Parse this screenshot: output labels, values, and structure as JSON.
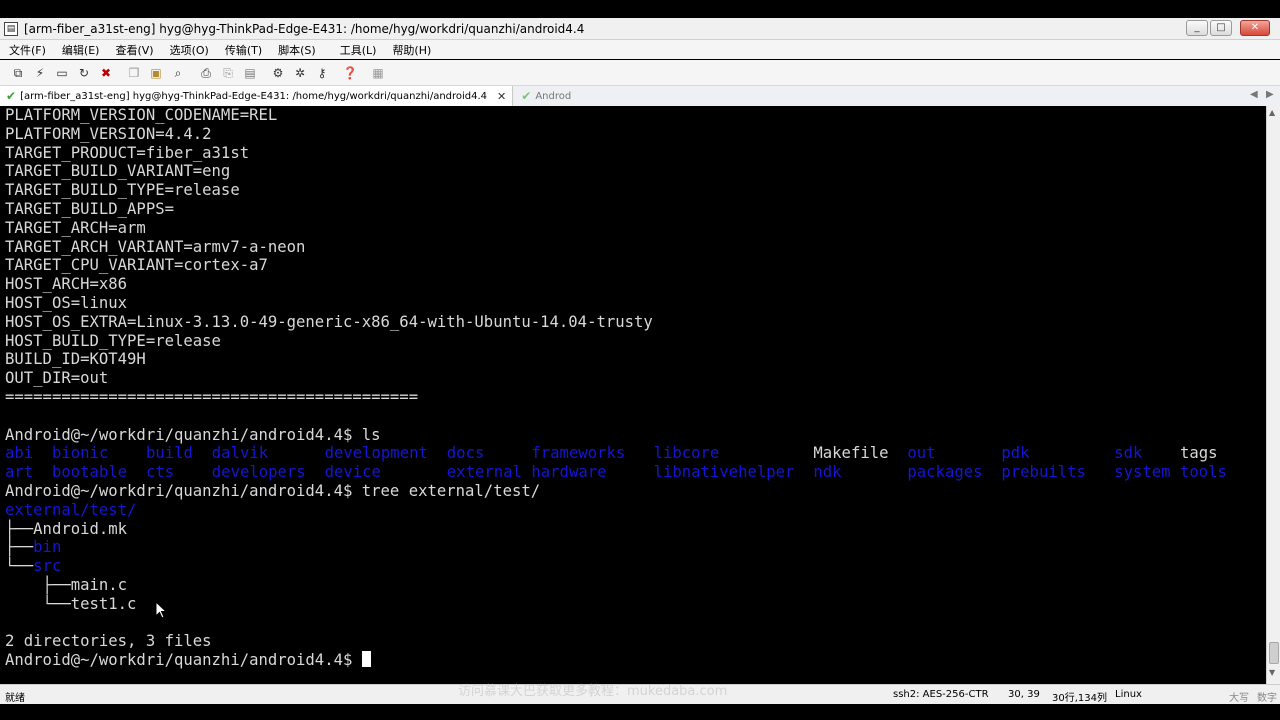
{
  "window": {
    "title": "[arm-fiber_a31st-eng] hyg@hyg-ThinkPad-Edge-E431: /home/hyg/workdri/quanzhi/android4.4",
    "icon": "terminal-app-icon"
  },
  "menu": {
    "file": "文件(F)",
    "edit": "编辑(E)",
    "view": "查看(V)",
    "options": "选项(O)",
    "transfer": "传输(T)",
    "script": "脚本(S)",
    "tools": "工具(L)",
    "help": "帮助(H)"
  },
  "toolbar": {
    "icons": [
      "connect-icon",
      "quick-connect-icon",
      "connect-tab-icon",
      "reconnect-icon",
      "disconnect-icon",
      "copy-icon",
      "paste-icon",
      "find-icon",
      "print-icon",
      "print-setup-icon",
      "print-screen-icon",
      "session-options-icon",
      "global-options-icon",
      "keymap-icon",
      "help-icon",
      "sftp-icon"
    ]
  },
  "tabs": {
    "session": "[arm-fiber_a31st-eng] hyg@hyg-ThinkPad-Edge-E431: /home/hyg/workdri/quanzhi/android4.4",
    "second": "Androd",
    "close": "✕",
    "ok_color": "#3aa13a"
  },
  "terminal": {
    "colors": {
      "fg": "#d8d8d8",
      "dir": "#1515d6",
      "bg": "#000000"
    },
    "lines_before": [
      "PLATFORM_VERSION_CODENAME=REL",
      "PLATFORM_VERSION=4.4.2",
      "TARGET_PRODUCT=fiber_a31st",
      "TARGET_BUILD_VARIANT=eng",
      "TARGET_BUILD_TYPE=release",
      "TARGET_BUILD_APPS=",
      "TARGET_ARCH=arm",
      "TARGET_ARCH_VARIANT=armv7-a-neon",
      "TARGET_CPU_VARIANT=cortex-a7",
      "HOST_ARCH=x86",
      "HOST_OS=linux",
      "HOST_OS_EXTRA=Linux-3.13.0-49-generic-x86_64-with-Ubuntu-14.04-trusty",
      "HOST_BUILD_TYPE=release",
      "BUILD_ID=KOT49H",
      "OUT_DIR=out",
      "============================================",
      "",
      "Android@~/workdri/quanzhi/android4.4$ ls"
    ],
    "ls_row1": [
      {
        "name": "abi",
        "dir": true
      },
      {
        "name": "bionic",
        "dir": true
      },
      {
        "name": "build",
        "dir": true
      },
      {
        "name": "dalvik",
        "dir": true
      },
      {
        "name": "development",
        "dir": true
      },
      {
        "name": "docs",
        "dir": true
      },
      {
        "name": "frameworks",
        "dir": true
      },
      {
        "name": "libcore",
        "dir": true
      },
      {
        "name": "Makefile",
        "dir": false
      },
      {
        "name": "out",
        "dir": true
      },
      {
        "name": "pdk",
        "dir": true
      },
      {
        "name": "sdk",
        "dir": true
      },
      {
        "name": "tags",
        "dir": false
      }
    ],
    "ls_row2": [
      {
        "name": "art",
        "dir": true
      },
      {
        "name": "bootable",
        "dir": true
      },
      {
        "name": "cts",
        "dir": true
      },
      {
        "name": "developers",
        "dir": true
      },
      {
        "name": "device",
        "dir": true
      },
      {
        "name": "external",
        "dir": true
      },
      {
        "name": "hardware",
        "dir": true
      },
      {
        "name": "libnativehelper",
        "dir": true
      },
      {
        "name": "ndk",
        "dir": true
      },
      {
        "name": "packages",
        "dir": true
      },
      {
        "name": "prebuilts",
        "dir": true
      },
      {
        "name": "system",
        "dir": true
      },
      {
        "name": "tools",
        "dir": true
      }
    ],
    "tree_cmd": "Android@~/workdri/quanzhi/android4.4$ tree external/test/",
    "tree_root": "external/test/",
    "tree": [
      {
        "prefix": "├──",
        "name": "Android.mk",
        "dir": false
      },
      {
        "prefix": "├──",
        "name": "bin",
        "dir": true
      },
      {
        "prefix": "└──",
        "name": "src",
        "dir": true
      },
      {
        "prefix": "    ├──",
        "name": "main.c",
        "dir": false
      },
      {
        "prefix": "    └──",
        "name": "test1.c",
        "dir": false
      }
    ],
    "summary": "2 directories, 3 files",
    "prompt": "Android@~/workdri/quanzhi/android4.4$ "
  },
  "status": {
    "ready": "就绪",
    "encryption": "ssh2: AES-256-CTR",
    "cursor_pos": "30, 39",
    "rows_cols": "30行,134列",
    "os": "Linux",
    "caps": "大写",
    "num": "数字"
  },
  "watermark": "访问慕课大巴获取更多教程：mukedaba.com"
}
